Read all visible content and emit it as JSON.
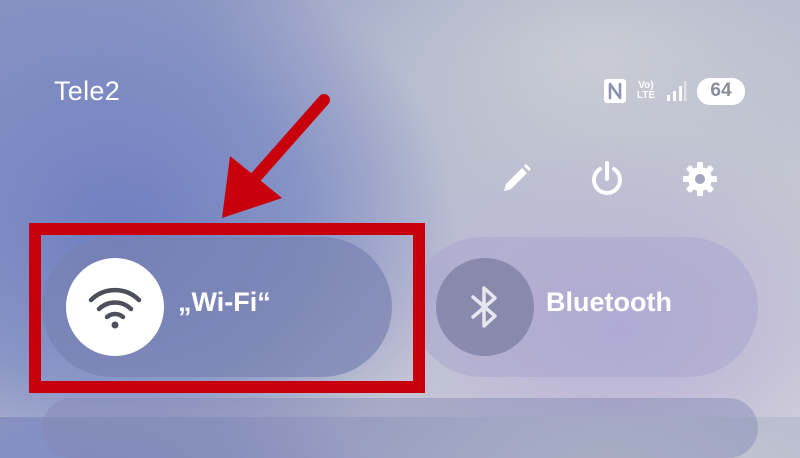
{
  "status_bar": {
    "carrier": "Tele2",
    "lte_top": "Vo)",
    "lte_bottom": "LTE",
    "battery": "64",
    "icons": [
      "nfc-icon",
      "volte-icon",
      "signal-icon",
      "battery-icon"
    ]
  },
  "quick_actions": {
    "icons": [
      "pencil-icon",
      "power-icon",
      "gear-icon"
    ]
  },
  "tiles": [
    {
      "label": "„Wi-Fi“",
      "icon": "wifi-icon",
      "active": true
    },
    {
      "label": "Bluetooth",
      "icon": "bluetooth-icon",
      "active": false
    }
  ],
  "annotation": {
    "color": "#c8000c"
  }
}
